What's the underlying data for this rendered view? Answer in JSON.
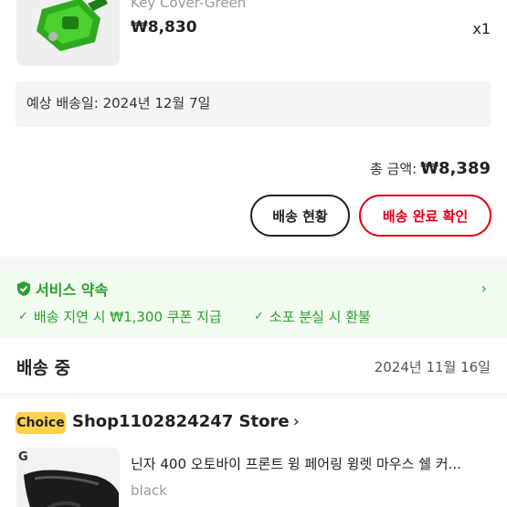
{
  "order_item": {
    "variant": "Key Cover-Green",
    "price": "₩8,830",
    "quantity": "x1"
  },
  "delivery": {
    "estimated": "예상 배송일: 2024년 12월 7일"
  },
  "total": {
    "label": "총 금액:",
    "amount": "₩8,389"
  },
  "buttons": {
    "track_label": "배송 현황",
    "confirm_label": "배송 완료 확인"
  },
  "service": {
    "title": "서비스 약속",
    "items": [
      "배송 지연 시 ₩1,300 쿠폰 지급",
      "소포 분실 시 환불"
    ],
    "accent_color": "#2aa12f"
  },
  "shipment": {
    "status": "배송 중",
    "date": "2024년 11월 16일"
  },
  "store": {
    "badge": "Choice",
    "name": "Shop1102824247 Store",
    "chevron": "›"
  },
  "next_item": {
    "title": "닌자 400 오토바이 프론트 윙 페어링 윙렛 마우스 쉘 커...",
    "variant": "black"
  },
  "colors": {
    "danger": "#e0001b",
    "badge": "#fcd24d"
  }
}
